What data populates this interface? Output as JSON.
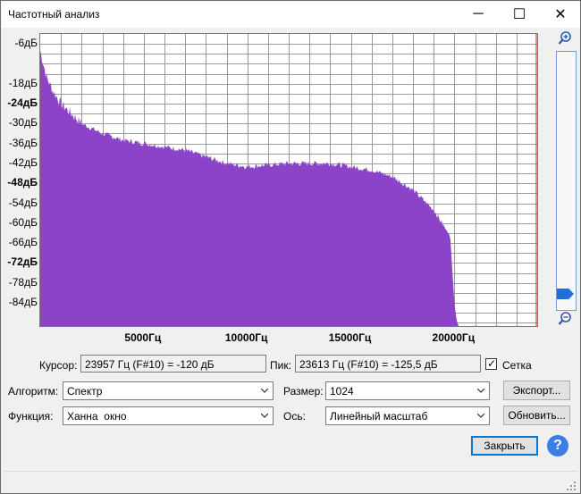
{
  "window": {
    "title": "Частотный анализ",
    "minimize": "─",
    "maximize": "☐",
    "close": "✕"
  },
  "y_axis": {
    "ticks": [
      "-6дБ",
      "-18дБ",
      "-24дБ",
      "-30дБ",
      "-36дБ",
      "-42дБ",
      "-48дБ",
      "-54дБ",
      "-60дБ",
      "-66дБ",
      "-72дБ",
      "-78дБ",
      "-84дБ"
    ]
  },
  "x_axis": {
    "ticks": [
      "5000Гц",
      "10000Гц",
      "15000Гц",
      "20000Гц"
    ]
  },
  "chart_data": {
    "type": "area",
    "x_unit": "Гц",
    "y_unit": "дБ",
    "x": [
      0,
      300,
      600,
      1000,
      1500,
      2000,
      3000,
      4000,
      5000,
      6000,
      7000,
      8000,
      9000,
      10000,
      11000,
      12000,
      13000,
      14000,
      15000,
      16000,
      17000,
      18000,
      19000,
      19500,
      19800,
      20000,
      20100,
      20200
    ],
    "y": [
      -8,
      -16,
      -20,
      -24,
      -27,
      -30,
      -33,
      -35,
      -36,
      -37,
      -38,
      -40,
      -42,
      -43,
      -42.5,
      -42,
      -42,
      -42,
      -43,
      -44,
      -46,
      -50,
      -56,
      -61,
      -64,
      -84,
      -89,
      -91
    ],
    "xlim": [
      0,
      24000
    ],
    "ylim": [
      -91,
      -3
    ],
    "grid": true,
    "cursor_x": 23957,
    "fill_color": "#8b44c8",
    "cursor_color": "#cc2020"
  },
  "controls": {
    "cursor_label": "Курсор:",
    "cursor_value": "23957 Гц (F#10) = -120 дБ",
    "peak_label": "Пик:",
    "peak_value": "23613 Гц (F#10) = -125,5 дБ",
    "grid_label": "Сетка",
    "grid_checked": "✓",
    "algorithm_label": "Алгоритм:",
    "algorithm_value": "Спектр",
    "size_label": "Размер:",
    "size_value": "1024",
    "export_button": "Экспорт...",
    "function_label": "Функция:",
    "function_value": "Ханна  окно",
    "axis_label": "Ось:",
    "axis_value": "Линейный масштаб",
    "update_button": "Обновить...",
    "close_button": "Закрыть",
    "help_button": "?"
  }
}
